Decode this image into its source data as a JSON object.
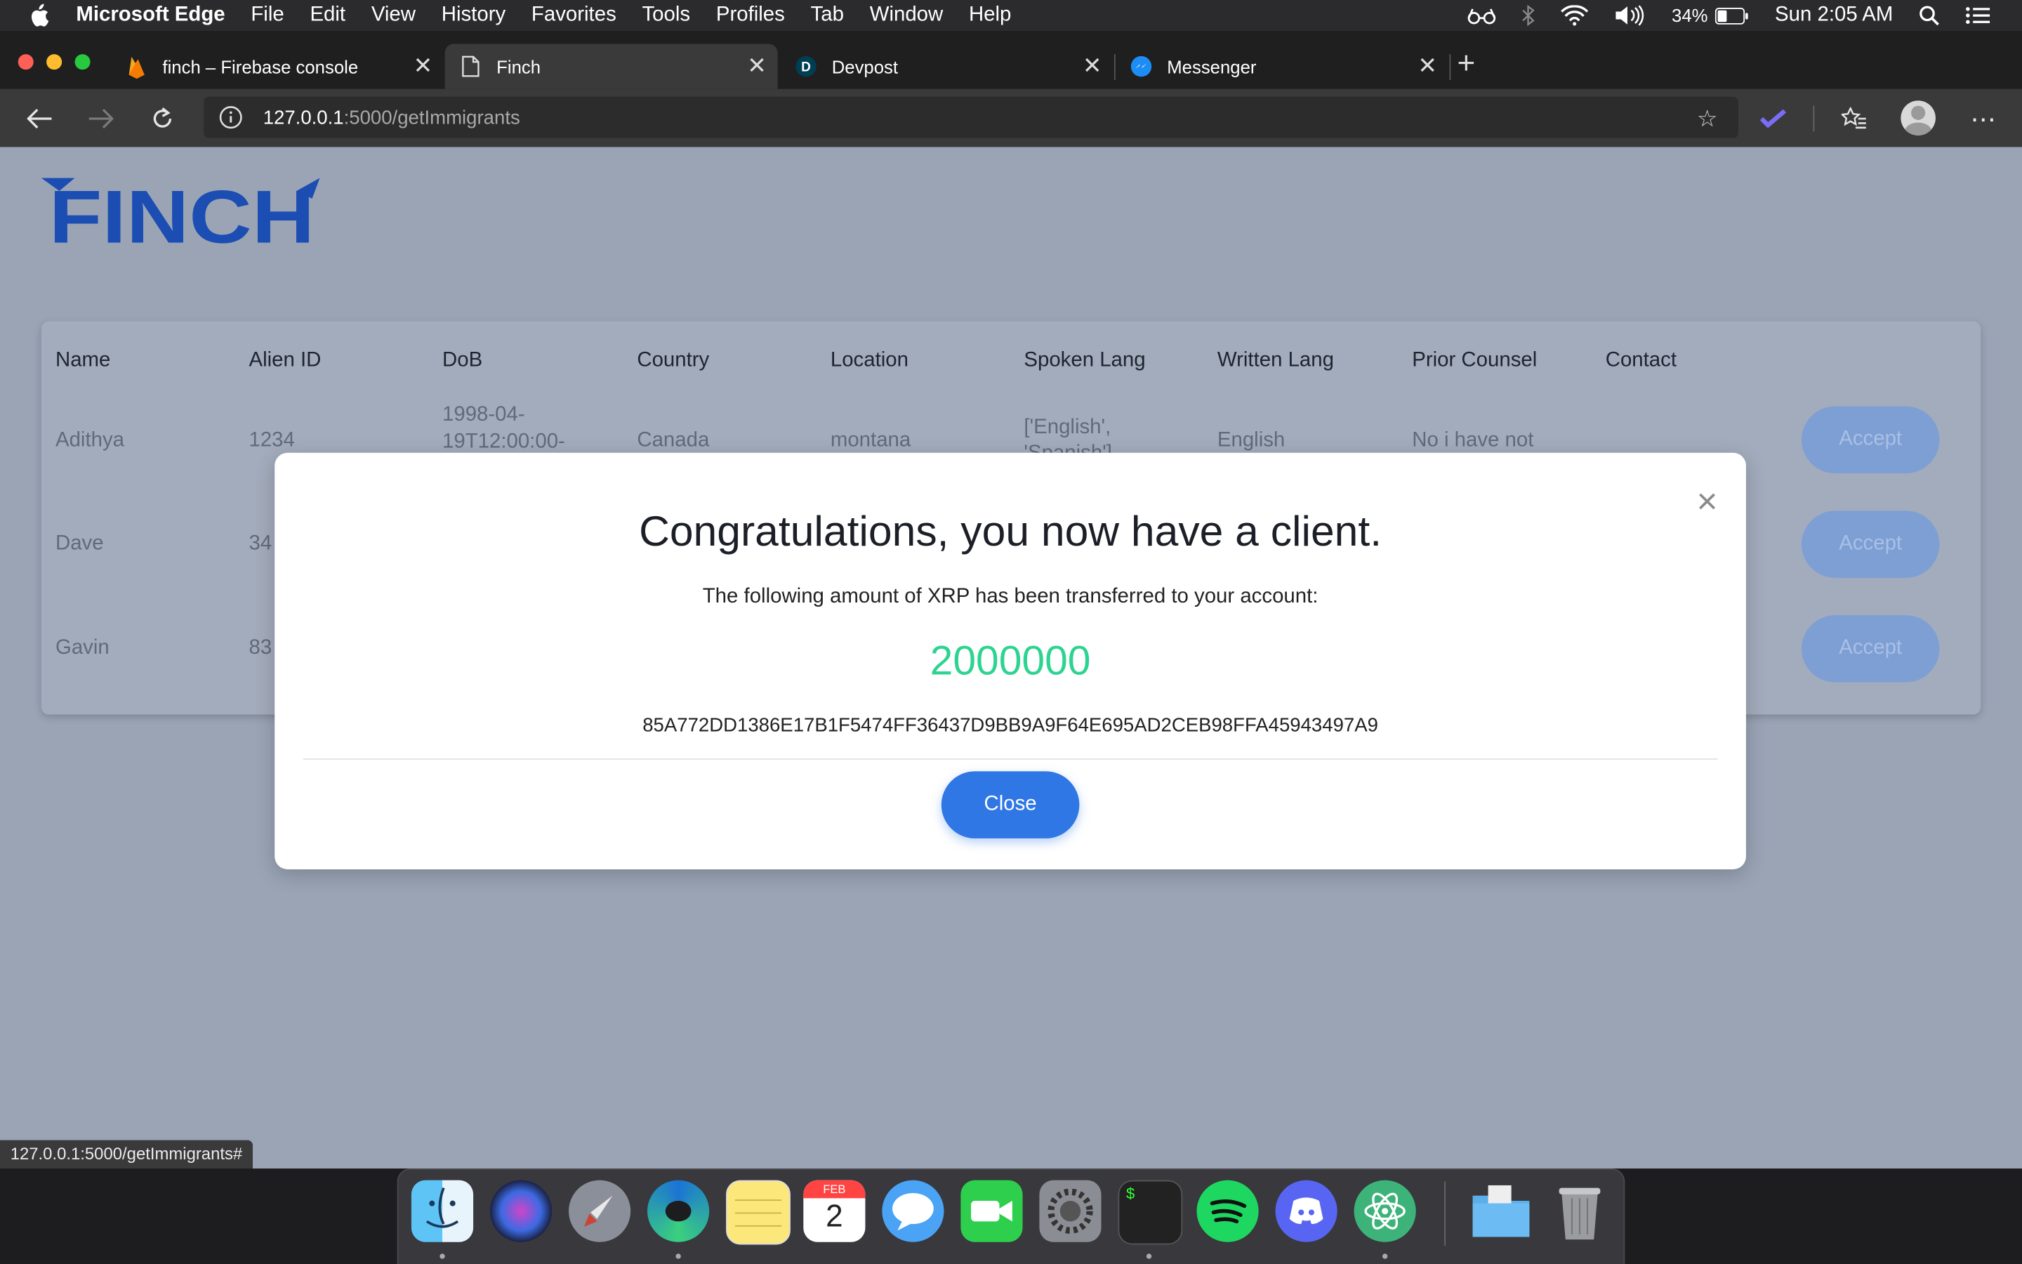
{
  "menubar": {
    "app_name": "Microsoft Edge",
    "menus": [
      "File",
      "Edit",
      "View",
      "History",
      "Favorites",
      "Tools",
      "Profiles",
      "Tab",
      "Window",
      "Help"
    ],
    "battery": "34%",
    "clock": "Sun 2:05 AM"
  },
  "tabs": [
    {
      "title": "finch – Firebase console",
      "icon": "firebase-icon"
    },
    {
      "title": "Finch",
      "icon": "page-icon"
    },
    {
      "title": "Devpost",
      "icon": "devpost-icon"
    },
    {
      "title": "Messenger",
      "icon": "messenger-icon"
    }
  ],
  "address": {
    "host": "127.0.0.1",
    "path": ":5000/getImmigrants"
  },
  "logo_text": "FINCH",
  "table": {
    "headers": [
      "Name",
      "Alien ID",
      "DoB",
      "Country",
      "Location",
      "Spoken Lang",
      "Written Lang",
      "Prior Counsel",
      "Contact"
    ],
    "rows": [
      {
        "name": "Adithya",
        "alien_id": "1234",
        "dob_line1": "1998-04-",
        "dob_line2": "19T12:00:00-",
        "country": "Canada",
        "location": "montana",
        "spoken_line1": "['English',",
        "spoken_line2": "'Spanish']",
        "written": "English",
        "prior": "No i have not",
        "action": "Accept"
      },
      {
        "name": "Dave",
        "alien_id": "34",
        "action": "Accept"
      },
      {
        "name": "Gavin",
        "alien_id": "83",
        "action": "Accept"
      }
    ]
  },
  "modal": {
    "close_symbol": "×",
    "title": "Congratulations, you now have a client.",
    "subtitle": "The following amount of XRP has been transferred to your account:",
    "amount": "2000000",
    "hash": "85A772DD1386E17B1F5474FF36437D9BB9A9F64E695AD2CEB98FFA45943497A9",
    "close_label": "Close"
  },
  "status_url": "127.0.0.1:5000/getImmigrants#",
  "dock": {
    "apps": [
      "finder",
      "siri",
      "launchpad",
      "edge",
      "notes",
      "calendar",
      "messages",
      "facetime",
      "system-preferences",
      "terminal",
      "spotify",
      "discord",
      "atom",
      "downloads-folder",
      "trash"
    ],
    "calendar_month": "FEB",
    "calendar_day": "2",
    "terminal_prompt": "$"
  },
  "colors": {
    "amount": "#2dd491",
    "close_button": "#2f77e4",
    "logo": "#1b4db3",
    "overlay_page": "#9aa4b5"
  }
}
